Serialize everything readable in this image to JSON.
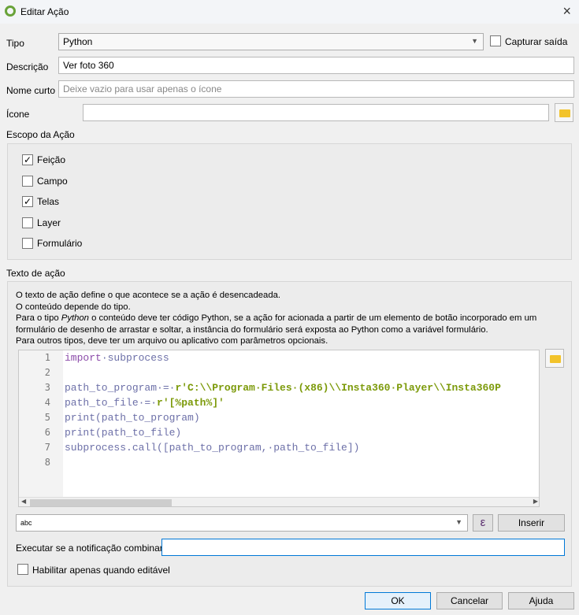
{
  "window": {
    "title": "Editar Ação",
    "close": "×"
  },
  "form": {
    "tipo_label": "Tipo",
    "tipo_value": "Python",
    "capturar_label": "Capturar saída",
    "descricao_label": "Descrição",
    "descricao_value": "Ver foto 360",
    "nome_label": "Nome curto",
    "nome_placeholder": "Deixe vazio para usar apenas o ícone",
    "icone_label": "Ícone"
  },
  "scope": {
    "title": "Escopo da Ação",
    "items": [
      {
        "label": "Feição",
        "checked": "✓"
      },
      {
        "label": "Campo",
        "checked": ""
      },
      {
        "label": "Telas",
        "checked": "✓"
      },
      {
        "label": "Layer",
        "checked": ""
      },
      {
        "label": "Formulário",
        "checked": ""
      }
    ]
  },
  "action": {
    "title": "Texto de ação",
    "desc1": "O texto de ação define o que acontece se a ação é desencadeada.",
    "desc2": "O conteúdo depende do tipo.",
    "desc3a": "Para o tipo ",
    "desc3em": "Python",
    "desc3b": " o conteúdo deve ter código Python, se a ação for acionada a partir de um elemento de botão incorporado em um",
    "desc4": "formulário de desenho de arrastar e soltar, a instância do formulário será exposta ao Python como a variável formulário.",
    "desc5": "Para outros tipos, deve ter um arquivo ou aplicativo com parâmetros opcionais.",
    "lines": [
      {
        "n": "1",
        "a": "import",
        "b": "·subprocess",
        "c": ""
      },
      {
        "n": "2",
        "a": "",
        "b": "",
        "c": ""
      },
      {
        "n": "3",
        "a": "",
        "b": "path_to_program·=·",
        "c": "r'C:\\\\Program·Files·(x86)\\\\Insta360·Player\\\\Insta360P"
      },
      {
        "n": "4",
        "a": "",
        "b": "path_to_file·=·",
        "c": "r'[%path%]'"
      },
      {
        "n": "5",
        "a": "",
        "b": "print(path_to_program)",
        "c": ""
      },
      {
        "n": "6",
        "a": "",
        "b": "print(path_to_file)",
        "c": ""
      },
      {
        "n": "7",
        "a": "",
        "b": "subprocess.call([path_to_program,·path_to_file])",
        "c": ""
      },
      {
        "n": "8",
        "a": "",
        "b": "",
        "c": ""
      }
    ],
    "field_value": "abc",
    "expr_icon": "ε",
    "insert": "Inserir",
    "notif_label": "Executar se a notificação combinar",
    "notif_value": "",
    "editable_label": "Habilitar apenas quando editável"
  },
  "buttons": {
    "ok": "OK",
    "cancel": "Cancelar",
    "help": "Ajuda"
  }
}
